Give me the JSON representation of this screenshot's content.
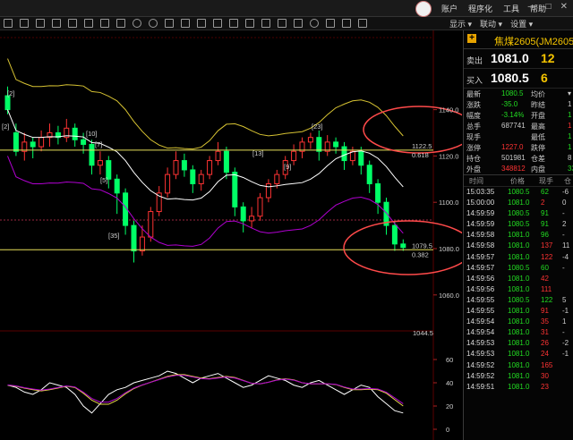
{
  "menu": [
    "账户",
    "程序化",
    "工具",
    "帮助"
  ],
  "window_buttons": [
    "—",
    "□",
    "✕"
  ],
  "toolbar_right": [
    "显示 ▾",
    "联动 ▾",
    "设置 ▾"
  ],
  "panel": {
    "plus": "+",
    "title": "焦煤2605(JM2605)"
  },
  "order_book": [
    {
      "label": "卖出",
      "price": "1081.0",
      "vol": "12"
    },
    {
      "label": "买入",
      "price": "1080.5",
      "vol": "6"
    }
  ],
  "quote": [
    {
      "k1": "最新",
      "v1": "1080.5",
      "c1": "#22dd22",
      "k2": "均价",
      "v2": "▾",
      "c2": "#cccccc"
    },
    {
      "k1": "涨跌",
      "v1": "-35.0",
      "c1": "#22dd22",
      "k2": "昨结",
      "v2": "1",
      "c2": "#cccccc"
    },
    {
      "k1": "幅度",
      "v1": "-3.14%",
      "c1": "#22dd22",
      "k2": "开盘",
      "v2": "1",
      "c2": "#22dd22"
    },
    {
      "k1": "总手",
      "v1": "687741",
      "c1": "#cccccc",
      "k2": "最高",
      "v2": "1",
      "c2": "#ff3333"
    },
    {
      "k1": "现手",
      "v1": "",
      "c1": "#cccccc",
      "k2": "最低",
      "v2": "1",
      "c2": "#22dd22"
    },
    {
      "k1": "涨停",
      "v1": "1227.0",
      "c1": "#ff3333",
      "k2": "跌停",
      "v2": "1",
      "c2": "#22dd22"
    },
    {
      "k1": "持仓",
      "v1": "501981",
      "c1": "#cccccc",
      "k2": "仓差",
      "v2": "8",
      "c2": "#cccccc"
    },
    {
      "k1": "外盘",
      "v1": "348812",
      "c1": "#ff3333",
      "k2": "内盘",
      "v2": "33",
      "c2": "#22dd22"
    }
  ],
  "ticks_header": [
    "时间",
    "价格",
    "现手",
    "仓"
  ],
  "ticks": [
    {
      "time": "15:03:35",
      "price": "1080.5",
      "vol": "62",
      "diff": "-6",
      "pc": "#22dd22",
      "vc": "#22dd22"
    },
    {
      "time": "15:00:00",
      "price": "1081.0",
      "vol": "2",
      "diff": "0",
      "pc": "#22dd22",
      "vc": "#ff3333"
    },
    {
      "time": "14:59:59",
      "price": "1080.5",
      "vol": "91",
      "diff": "-",
      "pc": "#22dd22",
      "vc": "#22dd22"
    },
    {
      "time": "14:59:59",
      "price": "1080.5",
      "vol": "91",
      "diff": "2",
      "pc": "#22dd22",
      "vc": "#22dd22"
    },
    {
      "time": "14:59:58",
      "price": "1081.0",
      "vol": "96",
      "diff": "-",
      "pc": "#22dd22",
      "vc": "#22dd22"
    },
    {
      "time": "14:59:58",
      "price": "1081.0",
      "vol": "137",
      "diff": "11",
      "pc": "#22dd22",
      "vc": "#ff3333"
    },
    {
      "time": "14:59:57",
      "price": "1081.0",
      "vol": "122",
      "diff": "-4",
      "pc": "#22dd22",
      "vc": "#ff3333"
    },
    {
      "time": "14:59:57",
      "price": "1080.5",
      "vol": "60",
      "diff": "-",
      "pc": "#22dd22",
      "vc": "#22dd22"
    },
    {
      "time": "14:59:56",
      "price": "1081.0",
      "vol": "42",
      "diff": "",
      "pc": "#22dd22",
      "vc": "#ff3333"
    },
    {
      "time": "14:59:56",
      "price": "1081.0",
      "vol": "111",
      "diff": "",
      "pc": "#22dd22",
      "vc": "#ff3333"
    },
    {
      "time": "14:59:55",
      "price": "1080.5",
      "vol": "122",
      "diff": "5",
      "pc": "#22dd22",
      "vc": "#22dd22"
    },
    {
      "time": "14:59:55",
      "price": "1081.0",
      "vol": "91",
      "diff": "-1",
      "pc": "#22dd22",
      "vc": "#ff3333"
    },
    {
      "time": "14:59:54",
      "price": "1081.0",
      "vol": "35",
      "diff": "1",
      "pc": "#22dd22",
      "vc": "#ff3333"
    },
    {
      "time": "14:59:54",
      "price": "1081.0",
      "vol": "31",
      "diff": "-",
      "pc": "#22dd22",
      "vc": "#ff3333"
    },
    {
      "time": "14:59:53",
      "price": "1081.0",
      "vol": "26",
      "diff": "-2",
      "pc": "#22dd22",
      "vc": "#ff3333"
    },
    {
      "time": "14:59:53",
      "price": "1081.0",
      "vol": "24",
      "diff": "-1",
      "pc": "#22dd22",
      "vc": "#ff3333"
    },
    {
      "time": "14:59:52",
      "price": "1081.0",
      "vol": "165",
      "diff": "",
      "pc": "#22dd22",
      "vc": "#ff3333"
    },
    {
      "time": "14:59:52",
      "price": "1081.0",
      "vol": "30",
      "diff": "",
      "pc": "#22dd22",
      "vc": "#ff3333"
    },
    {
      "time": "14:59:51",
      "price": "1081.0",
      "vol": "23",
      "diff": "",
      "pc": "#22dd22",
      "vc": "#ff3333"
    }
  ],
  "chart_data": {
    "type": "candlestick",
    "y_ticks": [
      "1140.0",
      "1120.0",
      "1100.0",
      "1080.0",
      "1060.0",
      "1044.5"
    ],
    "fib_labels": [
      {
        "price": "1122.5",
        "ratio": "0.618"
      },
      {
        "price": "1079.5",
        "ratio": "0.382"
      }
    ],
    "count_labels": [
      "[2]",
      "[2]",
      "[10]",
      "[7]",
      "[5]",
      "[35]",
      "[13]",
      "[9]",
      "[23]"
    ],
    "sub_y_ticks": [
      "60",
      "40",
      "20",
      "0"
    ],
    "colors": {
      "up": "#ff3333",
      "down": "#00ff66",
      "boll": "#d6c232",
      "mid": "#ffffff",
      "lower": "#b000d0",
      "fib": "#e8e05a",
      "ellipse": "#ff4a4a"
    }
  }
}
